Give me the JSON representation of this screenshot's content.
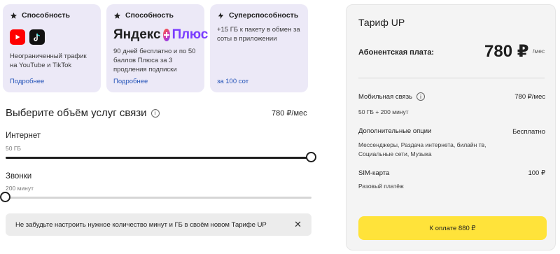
{
  "cards": [
    {
      "heading": "Способность",
      "description": "Неограниченный трафик на YouTube и TikTok",
      "link": "Подробнее"
    },
    {
      "heading": "Способность",
      "logo_brand": "Яндекс",
      "logo_plus": "Плюс",
      "description": "90 дней бесплатно и по 50 баллов Плюса за 3 продления подписки",
      "link": "Подробнее"
    },
    {
      "heading": "Суперспособность",
      "description": "+15 ГБ к пакету в обмен за соты в приложении",
      "link": "за 100 сот"
    }
  ],
  "section": {
    "title": "Выберите объём услуг связи",
    "price": "780 ₽/мес"
  },
  "sliders": {
    "internet": {
      "label": "Интернет",
      "value": "50 ГБ",
      "level": 1.0
    },
    "calls": {
      "label": "Звонки",
      "value": "200 минут",
      "level": 0.0
    }
  },
  "notice": {
    "text": "Не забудьте настроить нужное количество минут и ГБ в своём новом Тарифе UP",
    "close": "✕"
  },
  "tariff": {
    "title": "Тариф UP",
    "fee_label": "Абонентская плата:",
    "fee_price": "780 ₽",
    "fee_unit": "/мес",
    "mobile_label": "Мобильная связь",
    "mobile_price": "780 ₽/мес",
    "mobile_details": "50 ГБ  +  200 минут",
    "options_label": "Дополнительные опции",
    "options_price": "Бесплатно",
    "options_details": "Мессенджеры, Раздача интернета, билайн тв, Социальные сети, Музыка",
    "sim_label": "SIM-карта",
    "sim_price": "100 ₽",
    "sim_details": "Разовый платёж",
    "pay_button": "К оплате  880 ₽"
  },
  "colors": {
    "card_bg": "#ece9f7",
    "link": "#2453b8",
    "pay_button": "#ffe33a",
    "plus_purple": "#7a3cff"
  },
  "icons": [
    "star-icon",
    "lightning-icon",
    "youtube-icon",
    "tiktok-icon",
    "info-icon",
    "close-icon"
  ]
}
